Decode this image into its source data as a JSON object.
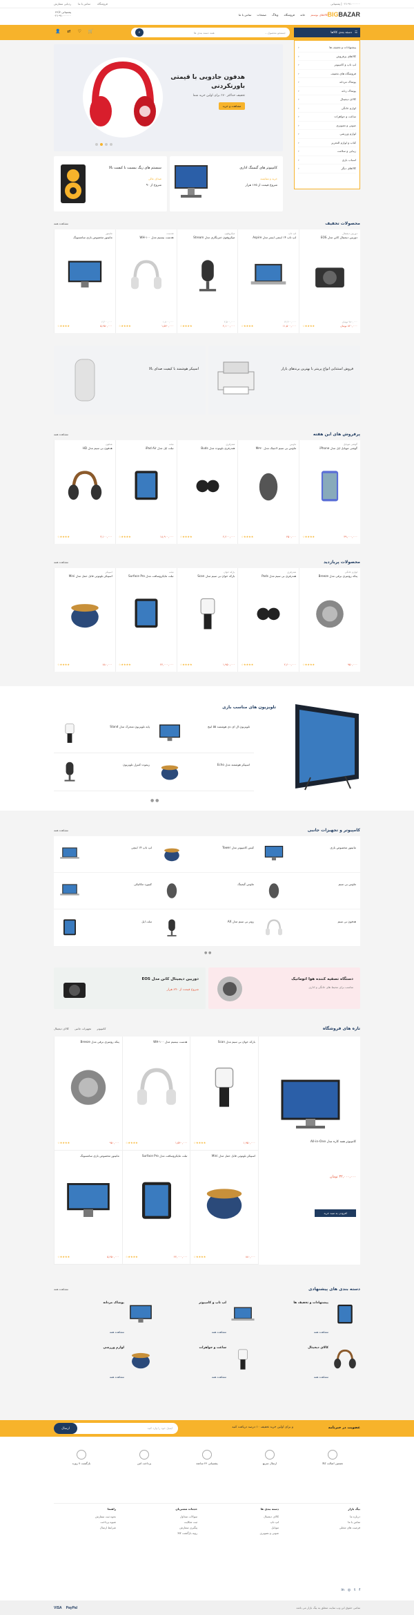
{
  "topbar": {
    "right": [
      "فروشگاه",
      "تماس با ما",
      "ردیابی سفارش"
    ],
    "left": "۰۲۱-۹۱۰۰۰۰۰۰ | پشتیبانی"
  },
  "header": {
    "logo_a": "BIG",
    "logo_b": "BAZAR",
    "nav": [
      "کالاهای نوستم",
      "خانه",
      "فروشگاه",
      "وبلاگ",
      "صفحات",
      "تماس با ما"
    ],
    "support": [
      "پشتیبانی ۲۴/۷",
      "۰۲۱-۹۱۰۰۰۰۰۰"
    ]
  },
  "searchbar": {
    "cat_label": "دسته بندی کالاها",
    "placeholder": "جستجو محصول...",
    "cat_select": "همه دسته بندی ها"
  },
  "categories": [
    "پیشنهادات و تخفیف ها",
    "کالاهای پرفروش",
    "لپ تاپ و کامپیوتر",
    "فروشگاه های تخفیف",
    "پوشاک مردانه",
    "پوشاک زنانه",
    "کالای دیجیتال",
    "لوازم خانگی",
    "ساعت و جواهرات",
    "صوتی و تصویری",
    "لوازم ورزشی",
    "کتاب و لوازم التحریر",
    "زیبایی و سلامت",
    "اسباب بازی",
    "کالاهای دیگر"
  ],
  "hero": {
    "title": "هدفون جادویی با قیمتی باورنکردنی",
    "sub": "تخفیف حداکثر ۷۰٪ برای اولین خرید شما",
    "btn": "مشاهده و خرید"
  },
  "promo1": {
    "title": "کامپیوتر های گیمینگ اداری",
    "sub": "خرید و مقایسه",
    "price": "شروع قیمت از ۱۶۵ هزار"
  },
  "promo2": {
    "title": "سیستم های زیگ بیسیت با کیفیت بالا",
    "sub": "صدای عالی",
    "price": "شروع از ۹۰"
  },
  "sections": {
    "sale": "محصولات تخفیف",
    "weekly": "پرفروش های این هفته",
    "popular": "محصولات پربازدید",
    "tv": "تلویزیون های مناسب بازی",
    "computer": "کامپیوتر و تجهیزات جانبی",
    "shop": "تازه های فروشگاه",
    "cats": "دسته بندی های پیشنهادی",
    "see_all": "مشاهده همه"
  },
  "sale_products": [
    {
      "cat": "دوربین دیجیتال",
      "name": "دوربین دیجیتال کانن مدل EOS",
      "old": "۹۸۰,۰۰۰ تومان",
      "price": "۸۲۰,۰۰۰ تومان"
    },
    {
      "cat": "لپ تاپ",
      "name": "لپ تاپ ۱۴ اینچی ایسر مدل Aspire",
      "old": "۱۲,۴۰۰,۰۰۰",
      "price": "۱۱,۵۰۰,۰۰۰"
    },
    {
      "cat": "میکروفون",
      "name": "میکروفون خبرنگاری مدل Stream",
      "old": "۲,۵۰۰,۰۰۰",
      "price": "۲,۱۰۰,۰۰۰"
    },
    {
      "cat": "هدست",
      "name": "هدست بیسیم مدل WH-۱۰۰",
      "old": "۱,۸۰۰,۰۰۰",
      "price": "۱,۵۴۰,۰۰۰"
    },
    {
      "cat": "مانیتور",
      "name": "مانیتور مخصوص بازی سامسونگ",
      "old": "۶,۲۰۰,۰۰۰",
      "price": "۵,۴۵۰,۰۰۰"
    }
  ],
  "weekly_products": [
    {
      "cat": "گوشی موبایل",
      "name": "گوشی موبایل اپل مدل iPhone",
      "price": "۳۹,۰۰۰,۰۰۰"
    },
    {
      "cat": "ماوس",
      "name": "ماوس بی سیم لاجیتک مدل M۳۳۰",
      "price": "۴۵۰,۰۰۰"
    },
    {
      "cat": "هندزفری",
      "name": "هندزفری بلوتوث مدل Buds",
      "price": "۲,۲۰۰,۰۰۰"
    },
    {
      "cat": "تبلت",
      "name": "تبلت اپل مدل iPad Air",
      "price": "۱۸,۹۰۰,۰۰۰"
    },
    {
      "cat": "هدفون",
      "name": "هدفون بی سیم مدل HD",
      "price": "۳,۱۰۰,۰۰۰"
    }
  ],
  "popular_products": [
    {
      "cat": "لوازم خانگی",
      "name": "پنکه رومیزی برقی مدل Breeze",
      "price": "۹۵۰,۰۰۰"
    },
    {
      "cat": "هندزفری",
      "name": "هندزفری بی سیم مدل Pods",
      "price": "۲,۶۰۰,۰۰۰"
    },
    {
      "cat": "بارکد خوان",
      "name": "بارکد خوان بی سیم مدل Scan",
      "price": "۱,۹۵۰,۰۰۰"
    },
    {
      "cat": "تبلت",
      "name": "تبلت مایکروسافت مدل Surface Pro",
      "price": "۲۴,۰۰۰,۰۰۰"
    },
    {
      "cat": "اسپیکر",
      "name": "اسپیکر بلوتوثی قابل حمل مدل Mini",
      "price": "۸۸۰,۰۰۰"
    }
  ],
  "tv_items": [
    "تلویزیون ال ای دی هوشمند ۵۵ اینچ",
    "پایه تلویزیون متحرک مدل Stand",
    "اسپیکر هوشمند مدل Echo",
    "ریموت کنترل تلویزیون"
  ],
  "computer_items": [
    "مانیتور مخصوص بازی",
    "کیس کامپیوتر مدل Tower",
    "لپ تاپ ۱۴ اینچی",
    "ماوس بی سیم",
    "ماوس گیمینگ",
    "کیبورد مکانیکی",
    "هدفون بی سیم",
    "روتر بی سیم مدل AX",
    "تبلت اپل"
  ],
  "mid_banners": {
    "left": {
      "title": "دوربین دیجیتال کانن مدل EOS",
      "price": "شروع قیمت از ۸۹۰ هزار"
    },
    "right": {
      "title": "دستگاه تصفیه کننده هوا اتوماتیک",
      "sub": "مناسب برای محیط های خانگی و اداری"
    }
  },
  "shop_tabs": [
    "کالای دیجیتال",
    "تجهیزات جانبی",
    "کامپیوتر"
  ],
  "featured": {
    "name": "کامپیوتر همه کاره مدل All-in-One",
    "price": "۳۲,۰۰۰,۰۰۰ تومان",
    "btn": "افزودن به سبد خرید"
  },
  "newsletter": {
    "label": "عضویت در خبرنامه",
    "text": "و برای اولین خرید تخفیف ۱۰ درصد دریافت کنید",
    "placeholder": "ایمیل خود را وارد کنید",
    "btn": "ارسال"
  },
  "features": [
    "تضمین اصالت کالا",
    "ارسال سریع",
    "پشتیبانی ۲۴ ساعته",
    "پرداخت امن",
    "بازگشت ۷ روزه"
  ],
  "footer_cols": [
    {
      "h": "بیگ بازار",
      "items": [
        "درباره ما",
        "تماس با ما",
        "فرصت های شغلی"
      ]
    },
    {
      "h": "دسته بندی ها",
      "items": [
        "کالای دیجیتال",
        "لپ تاپ",
        "موبایل",
        "صوتی و تصویری"
      ]
    },
    {
      "h": "خدمات مشتریان",
      "items": [
        "سوالات متداول",
        "ثبت شکایت",
        "پیگیری سفارش",
        "رویه بازگشت کالا"
      ]
    },
    {
      "h": "راهنما",
      "items": [
        "نحوه ثبت سفارش",
        "شیوه پرداخت",
        "شرایط ارسال"
      ]
    }
  ],
  "copyright": "تمامی حقوق این وب سایت متعلق به بیگ بازار می باشد",
  "payments": [
    "PayPal",
    "VISA"
  ]
}
